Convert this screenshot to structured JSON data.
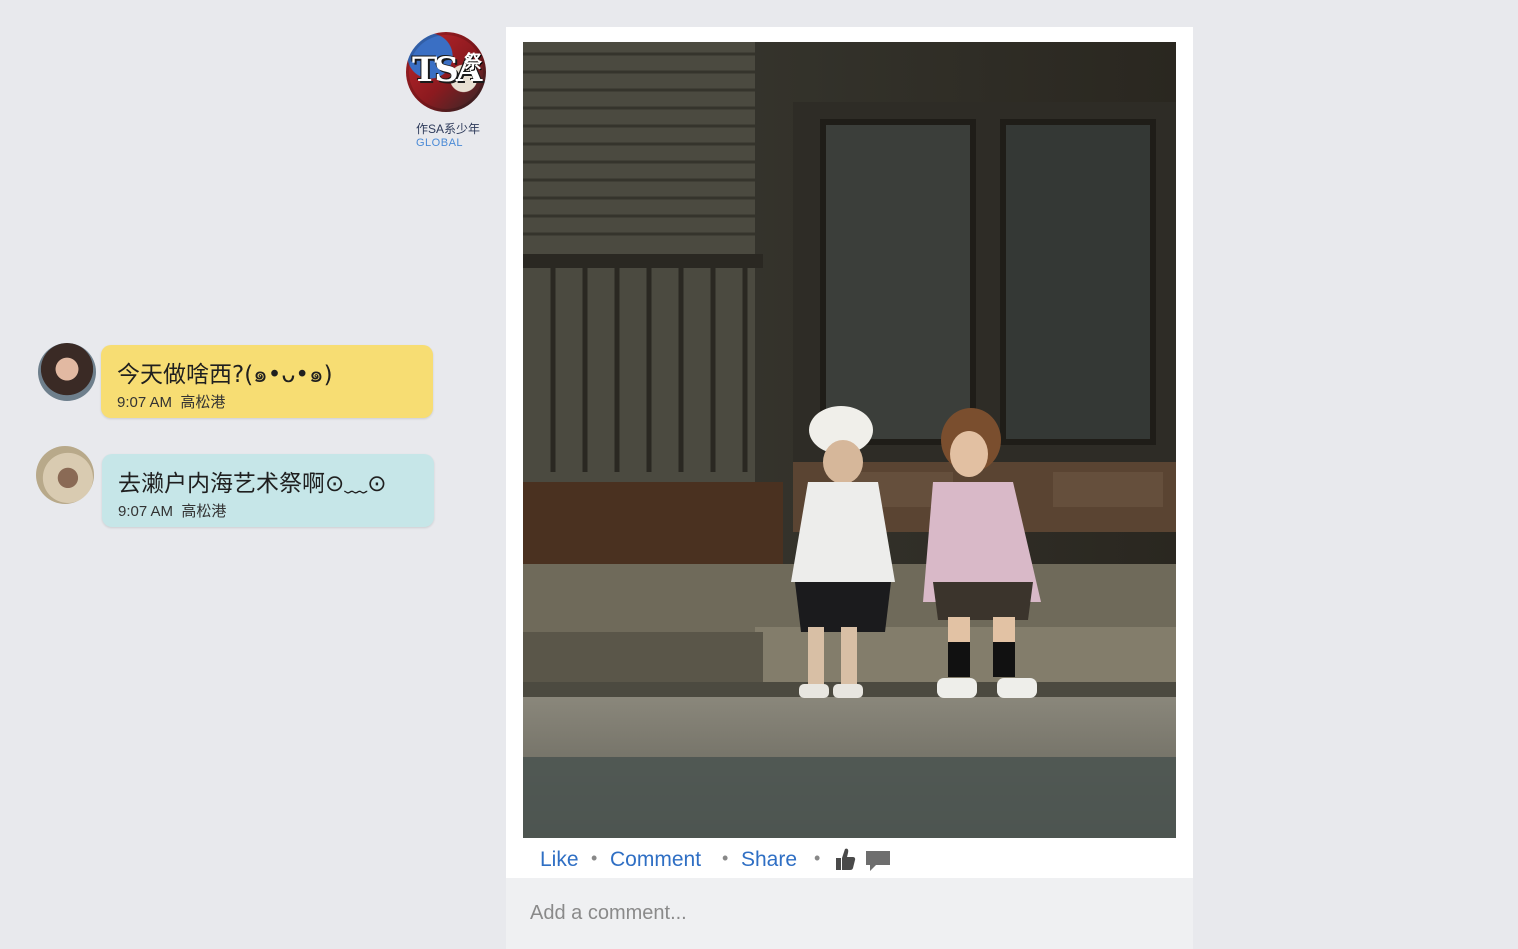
{
  "brand": {
    "logo_text": "TSA",
    "logo_side": "祭",
    "name": "作SA系少年",
    "subtitle": "GLOBAL"
  },
  "chat": {
    "messages": [
      {
        "text": "今天做啥西?(๑•ᴗ•๑)",
        "time": "9:07 AM",
        "location": "高松港",
        "color": "#f7dd73"
      },
      {
        "text": "去濑户内海艺术祭啊⊙﹏⊙",
        "time": "9:07 AM",
        "location": "高松港",
        "color": "#c6e6e8"
      }
    ]
  },
  "post": {
    "actions": {
      "like": "Like",
      "comment": "Comment",
      "share": "Share",
      "separator": "•"
    },
    "comment_placeholder": "Add a comment..."
  },
  "colors": {
    "background": "#e8e9ed",
    "link": "#2f6fc4",
    "brand_subtitle": "#4a8ad6"
  }
}
